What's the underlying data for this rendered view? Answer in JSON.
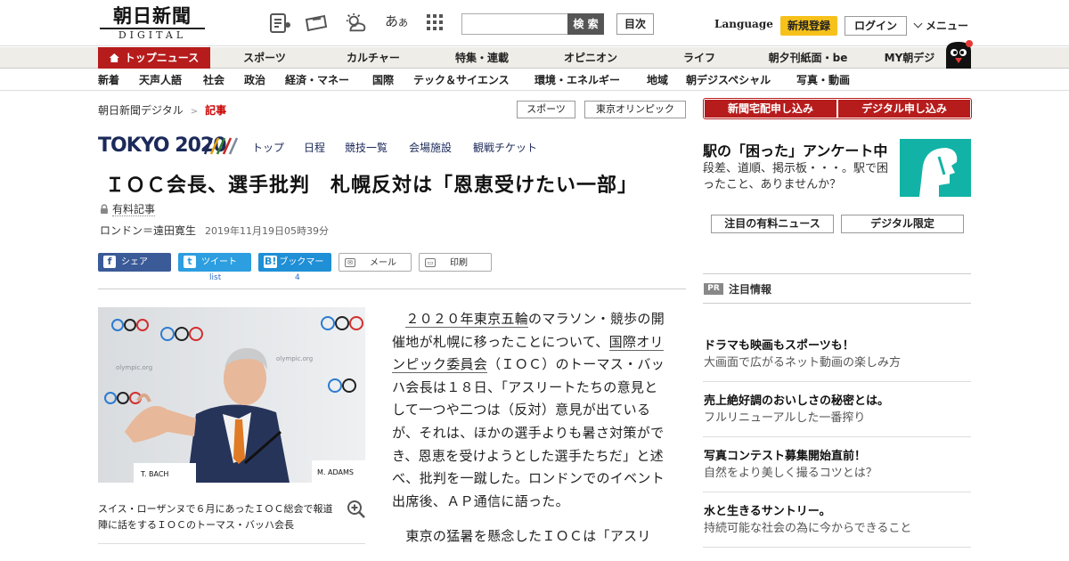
{
  "header": {
    "logo_jp": "朝日新聞",
    "logo_en": "DIGITAL",
    "aa_label": "あ",
    "aa_small": "あ",
    "search_button": "検 索",
    "search_placeholder": "",
    "mokuji": "目次",
    "language": "Language",
    "register": "新規登録",
    "login": "ログイン",
    "menu": "メニュー"
  },
  "nav_primary": [
    "トップニュース",
    "スポーツ",
    "カルチャー",
    "特集・連載",
    "オピニオン",
    "ライフ",
    "朝夕刊紙面・be",
    "MY朝デジ"
  ],
  "nav_secondary": [
    "新着",
    "天声人語",
    "社会",
    "政治",
    "経済・マネー",
    "国際",
    "テック＆サイエンス",
    "環境・エネルギー",
    "地域",
    "朝デジスペシャル",
    "写真・動画"
  ],
  "breadcrumb": {
    "home": "朝日新聞デジタル",
    "sep": ">",
    "current": "記事"
  },
  "tags": [
    "スポーツ",
    "東京オリンピック"
  ],
  "tokyo": {
    "logo": "TOKYO 2020",
    "nav": [
      "トップ",
      "日程",
      "競技一覧",
      "会場施設",
      "観戦チケット"
    ]
  },
  "article": {
    "title": "ＩＯＣ会長、選手批判　札幌反対は「恩恵受けたい一部」",
    "paid_label": "有料記事",
    "author": "ロンドン＝遠田寛生",
    "date": "2019年11月19日05時39分",
    "photo_caption": "スイス・ローザンヌで６月にあったＩＯＣ総会で報道陣に話をするＩＯＣのトーマス・バッハ会長",
    "photo_nameplate_left": "T. BACH",
    "photo_nameplate_right": "M. ADAMS",
    "photo_backdrop": "olympic.org",
    "p1_link1": "２０２０年東京五輪",
    "p1_a": "のマラソン・競歩の開催地が札幌に移ったことについて、",
    "p1_link2": "国際オリンピック委員会",
    "p1_b": "（ＩＯＣ）のトーマス・バッハ会長は１８日、「アスリートたちの意見として一つや二つは（反対）意見が出ているが、それは、ほかの選手よりも暑さ対策ができ、恩恵を受けようとした選手たちだ」と述べ、批判を一蹴した。ロンドンでのイベント出席後、ＡＰ通信に語った。",
    "p2": "東京の猛暑を懸念したＩＯＣは「アスリ"
  },
  "share": {
    "facebook": "シェア",
    "twitter": "ツイート",
    "twitter_count": "list",
    "hatena": "ブックマーク",
    "hatena_count": "4",
    "mail": "メール",
    "print": "印刷"
  },
  "sidebar": {
    "red_buttons": [
      "新聞宅配申し込み",
      "デジタル申し込み"
    ],
    "eki_title": "駅の「困った」アンケート中",
    "eki_body": "段差、道順、掲示板・・・。駅で困ったこと、ありませんか？",
    "pills": [
      "注目の有料ニュース",
      "デジタル限定"
    ],
    "pr_tag": "PR",
    "pr_title": "注目情報",
    "ads": [
      {
        "h": "ドラマも映画もスポーツも！",
        "s": "大画面で広がるネット動画の楽しみ方"
      },
      {
        "h": "売上絶好調のおいしさの秘密とは。",
        "s": "フルリニューアルした一番搾り"
      },
      {
        "h": "写真コンテスト募集開始直前！",
        "s": "自然をより美しく撮るコツとは？"
      },
      {
        "h": "水と生きるサントリー。",
        "s": "持続可能な社会の為に今からできること"
      }
    ]
  },
  "colors": {
    "brand_red": "#b71c1c",
    "tokyo_navy": "#1c2a5a",
    "register_yellow": "#f7c11b",
    "eki_teal": "#12b3a6"
  }
}
